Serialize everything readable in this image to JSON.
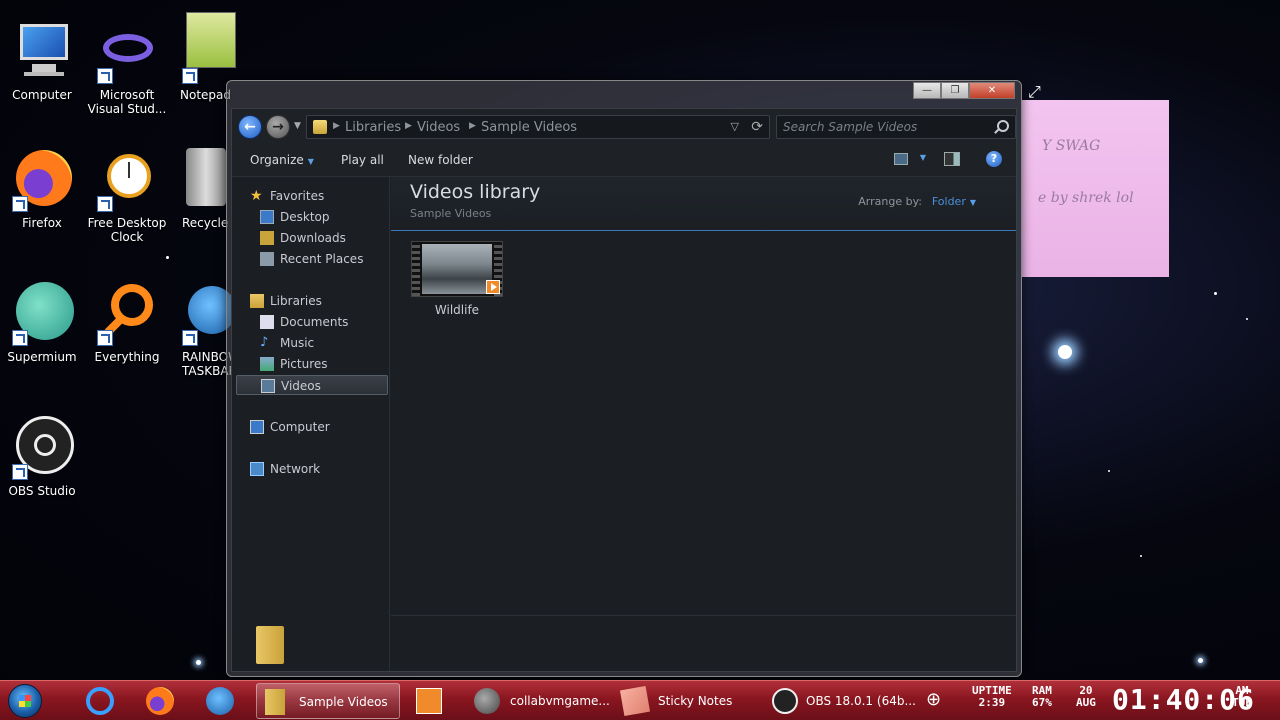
{
  "desktop": {
    "icons": [
      {
        "label": "Computer"
      },
      {
        "label": "Microsoft Visual Stud..."
      },
      {
        "label": "Notepad"
      },
      {
        "label": "Firefox"
      },
      {
        "label": "Free Desktop Clock"
      },
      {
        "label": "Recycle"
      },
      {
        "label": "Supermium"
      },
      {
        "label": "Everything"
      },
      {
        "label": "RAINBOW TASKBAR"
      },
      {
        "label": "OBS Studio"
      }
    ]
  },
  "sticky_note": {
    "line1": "Y SWAG",
    "line2": "e by shrek lol"
  },
  "window": {
    "controls": {
      "minimize": "—",
      "maximize": "❐",
      "close": "✕"
    },
    "address": {
      "crumbs": [
        "Libraries",
        "Videos",
        "Sample Videos"
      ]
    },
    "search": {
      "placeholder": "Search Sample Videos"
    },
    "toolbar": {
      "organize": "Organize",
      "play_all": "Play all",
      "new_folder": "New folder",
      "help": "?"
    },
    "nav": {
      "favorites": "Favorites",
      "desktop": "Desktop",
      "downloads": "Downloads",
      "recent_places": "Recent Places",
      "libraries": "Libraries",
      "documents": "Documents",
      "music": "Music",
      "pictures": "Pictures",
      "videos": "Videos",
      "computer": "Computer",
      "network": "Network"
    },
    "library": {
      "title": "Videos library",
      "subtitle": "Sample Videos",
      "arrange_label": "Arrange by:",
      "arrange_value": "Folder"
    },
    "files": [
      {
        "name": "Wildlife"
      }
    ]
  },
  "taskbar": {
    "buttons": {
      "sample_videos": "Sample Videos",
      "collabvm": "collabvmgame...",
      "sticky_notes": "Sticky Notes",
      "obs": "OBS 18.0.1 (64b..."
    },
    "gadgets": {
      "uptime_label": "UPTIME",
      "uptime_value": "2:39",
      "ram_label": "RAM",
      "ram_value": "67%",
      "date_day": "20",
      "date_month": "AUG",
      "clock": "01:40:06",
      "ampm": "AM",
      "weekday": "TUE"
    }
  },
  "colors": {
    "accent": "#4a8fd8",
    "taskbar": "#8a1620",
    "window_bg": "#1b1f24",
    "sticky": "#eab3e6"
  }
}
